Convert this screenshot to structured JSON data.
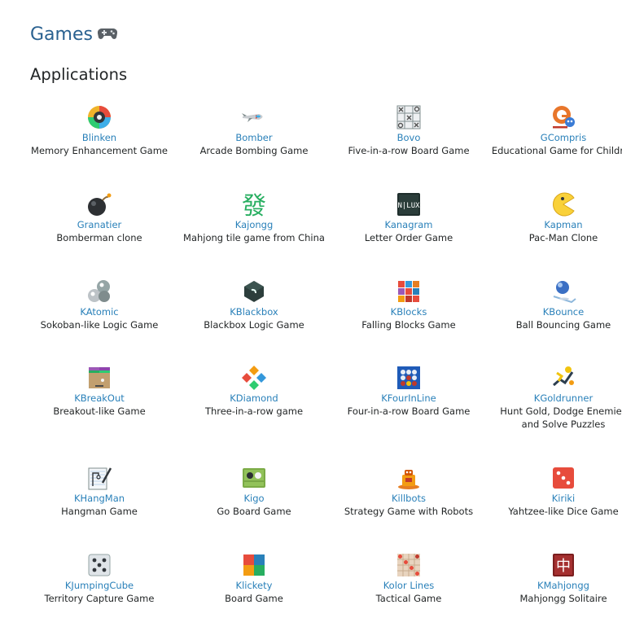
{
  "header": {
    "title": "Games",
    "section": "Applications"
  },
  "apps": [
    {
      "name": "Blinken",
      "desc": "Memory Enhancement Game",
      "icon": "blinken-icon"
    },
    {
      "name": "Bomber",
      "desc": "Arcade Bombing Game",
      "icon": "bomber-icon"
    },
    {
      "name": "Bovo",
      "desc": "Five-in-a-row Board Game",
      "icon": "bovo-icon"
    },
    {
      "name": "GCompris",
      "desc": "Educational Game for Children",
      "icon": "gcompris-icon"
    },
    {
      "name": "Granatier",
      "desc": "Bomberman clone",
      "icon": "granatier-icon"
    },
    {
      "name": "Kajongg",
      "desc": "Mahjong tile game from China",
      "icon": "kajongg-icon"
    },
    {
      "name": "Kanagram",
      "desc": "Letter Order Game",
      "icon": "kanagram-icon"
    },
    {
      "name": "Kapman",
      "desc": "Pac-Man Clone",
      "icon": "kapman-icon"
    },
    {
      "name": "KAtomic",
      "desc": "Sokoban-like Logic Game",
      "icon": "katomic-icon"
    },
    {
      "name": "KBlackbox",
      "desc": "Blackbox Logic Game",
      "icon": "kblackbox-icon"
    },
    {
      "name": "KBlocks",
      "desc": "Falling Blocks Game",
      "icon": "kblocks-icon"
    },
    {
      "name": "KBounce",
      "desc": "Ball Bouncing Game",
      "icon": "kbounce-icon"
    },
    {
      "name": "KBreakOut",
      "desc": "Breakout-like Game",
      "icon": "kbreakout-icon"
    },
    {
      "name": "KDiamond",
      "desc": "Three-in-a-row game",
      "icon": "kdiamond-icon"
    },
    {
      "name": "KFourInLine",
      "desc": "Four-in-a-row Board Game",
      "icon": "kfourinline-icon"
    },
    {
      "name": "KGoldrunner",
      "desc": "Hunt Gold, Dodge Enemies and Solve Puzzles",
      "icon": "kgoldrunner-icon"
    },
    {
      "name": "KHangMan",
      "desc": "Hangman Game",
      "icon": "khangman-icon"
    },
    {
      "name": "Kigo",
      "desc": "Go Board Game",
      "icon": "kigo-icon"
    },
    {
      "name": "Killbots",
      "desc": "Strategy Game with Robots",
      "icon": "killbots-icon"
    },
    {
      "name": "Kiriki",
      "desc": "Yahtzee-like Dice Game",
      "icon": "kiriki-icon"
    },
    {
      "name": "KJumpingCube",
      "desc": "Territory Capture Game",
      "icon": "kjumpingcube-icon"
    },
    {
      "name": "Klickety",
      "desc": "Board Game",
      "icon": "klickety-icon"
    },
    {
      "name": "Kolor Lines",
      "desc": "Tactical Game",
      "icon": "kolorlines-icon"
    },
    {
      "name": "KMahjongg",
      "desc": "Mahjongg Solitaire",
      "icon": "kmahjongg-icon"
    }
  ]
}
